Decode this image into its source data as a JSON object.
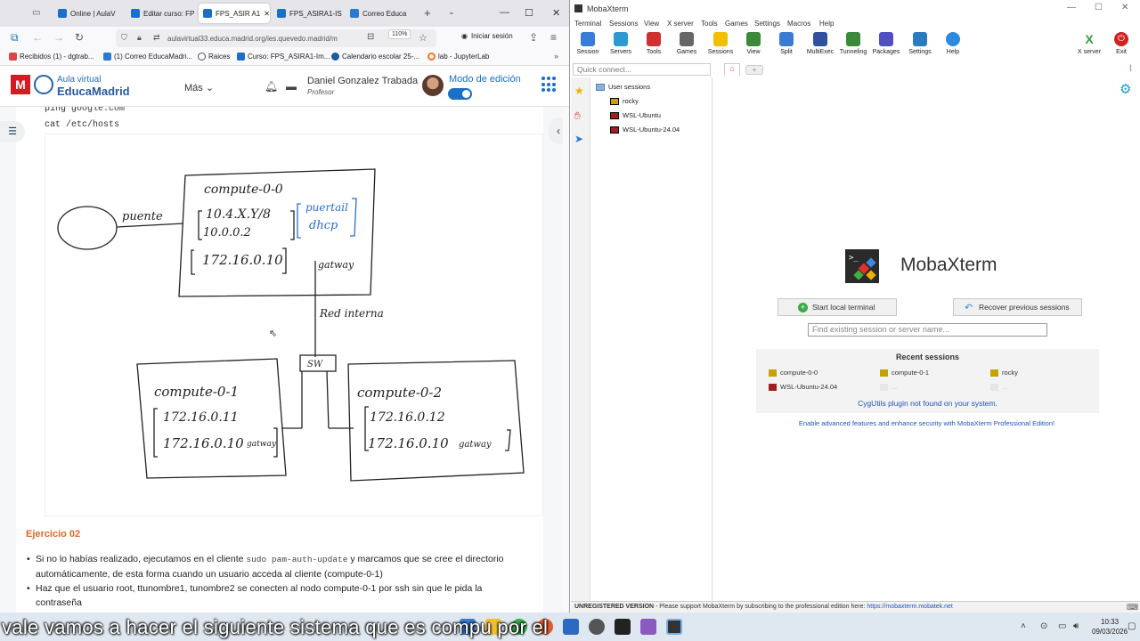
{
  "browser": {
    "tabs": [
      {
        "label": "Online | AulaV"
      },
      {
        "label": "Editar curso: FP"
      },
      {
        "label": "FPS_ASIR A1"
      },
      {
        "label": "FPS_ASIRA1-IS"
      },
      {
        "label": "Correo Educa"
      }
    ],
    "url": "aulavirtual33.educa.madrid.org/ies.quevedo.madrid/m",
    "zoom": "110%",
    "sign_in": "Iniciar sesión",
    "bookmarks": [
      {
        "label": "Recibidos (1) - dgtrab..."
      },
      {
        "label": "(1) Correo EducaMadri..."
      },
      {
        "label": "Raices"
      },
      {
        "label": "Curso: FPS_ASIRA1-Im..."
      },
      {
        "label": "Calendario escolar 25-..."
      },
      {
        "label": "lab - JupyterLab"
      }
    ]
  },
  "site": {
    "brand_small": "Aula virtual",
    "brand_big": "EducaMadrid",
    "more": "Más",
    "user_name": "Daniel Gonzalez Trabada",
    "user_role": "Profesor",
    "edit_mode": "Modo de edición"
  },
  "page": {
    "code_lines": [
      "ping google.com",
      "cat /etc/hosts"
    ],
    "diagram": {
      "compute00": "compute-0-0",
      "ip_dhcp": "10.4.X.Y/8",
      "ip_gw": "10.0.0.2",
      "note1": "puertail",
      "note2": "dhcp",
      "ip_int": "172.16.0.10",
      "gateway": "gatway",
      "bridge": "puente",
      "internal": "Red interna",
      "switch": "SW",
      "compute01": "compute-0-1",
      "c01_ip": "172.16.0.11",
      "c01_gw": "172.16.0.10",
      "compute02": "compute-0-2",
      "c02_ip": "172.16.0.12",
      "c02_gw": "172.16.0.10",
      "gw_label": "gatway"
    },
    "exercise_title": "Ejercicio 02",
    "bullet1_a": "Si no lo habías realizado, ejecutamos en el cliente ",
    "bullet1_code": "sudo pam-auth-update",
    "bullet1_b": " y marcamos que se cree el directorio automáticamente, de esta forma cuando un usuario acceda al cliente (compute-0-1)",
    "bullet2": "Haz que el usuario root, ttunombre1, tunombre2 se conecten al nodo compute-0-1 por ssh sin que le pida la contraseña"
  },
  "moba": {
    "title": "MobaXterm",
    "menu": [
      "Terminal",
      "Sessions",
      "View",
      "X server",
      "Tools",
      "Games",
      "Settings",
      "Macros",
      "Help"
    ],
    "toolbar": [
      {
        "label": "Session",
        "color": "#3a7bd5"
      },
      {
        "label": "Servers",
        "color": "#2a9ad0"
      },
      {
        "label": "Tools",
        "color": "#d03030"
      },
      {
        "label": "Games",
        "color": "#666666"
      },
      {
        "label": "Sessions",
        "color": "#f0c000"
      },
      {
        "label": "View",
        "color": "#3a8a3a"
      },
      {
        "label": "Split",
        "color": "#3a7bd5"
      },
      {
        "label": "MultiExec",
        "color": "#3050a0"
      },
      {
        "label": "Tunneling",
        "color": "#3a8a3a"
      },
      {
        "label": "Packages",
        "color": "#5050c0"
      },
      {
        "label": "Settings",
        "color": "#2a7ac0"
      },
      {
        "label": "Help",
        "color": "#2a8ae0"
      }
    ],
    "xserver": "X server",
    "exit": "Exit",
    "quick_connect": "Quick connect...",
    "tree_root": "User sessions",
    "tree_items": [
      "rocky",
      "WSL-Ubuntu",
      "WSL-Ubuntu-24.04"
    ],
    "product": "MobaXterm",
    "start_terminal": "Start local terminal",
    "recover": "Recover previous sessions",
    "search_placeholder": "Find existing session or server name...",
    "recent_title": "Recent sessions",
    "recent": [
      "compute-0-0",
      "compute-0-1",
      "rocky",
      "WSL-Ubuntu-24.04",
      "...",
      "..."
    ],
    "cygutils": "CygUtils plugin not found on your system.",
    "pro_link": "Enable advanced features and enhance security with MobaXterm Professional Edition!",
    "status_bold": "UNREGISTERED VERSION",
    "status_text": " -  Please support MobaXterm by subscribing to the professional edition here: ",
    "status_link": "https://mobaxterm.mobatek.net"
  },
  "taskbar": {
    "subtitle": "vale vamos a hacer el siguiente sistema que es compu por el",
    "time": "10:33",
    "date": "09/03/2026"
  }
}
